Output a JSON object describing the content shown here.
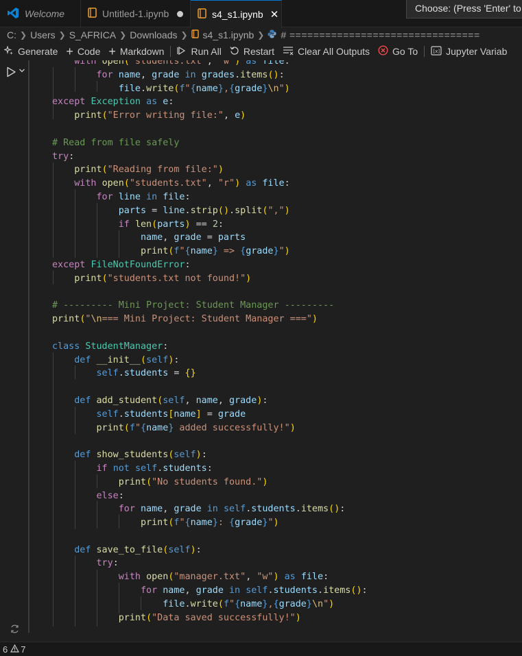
{
  "tabs": [
    {
      "label": "Welcome"
    },
    {
      "label": "Untitled-1.ipynb"
    },
    {
      "label": "s4_s1.ipynb"
    }
  ],
  "command_prompt": "Choose: (Press 'Enter' to co",
  "breadcrumb": {
    "drive": "C:",
    "parts": [
      "Users",
      "S_AFRICA",
      "Downloads",
      "s4_s1.ipynb"
    ],
    "cell": "# ================================"
  },
  "toolbar": {
    "generate": "Generate",
    "code": "Code",
    "markdown": "Markdown",
    "run_all": "Run All",
    "restart": "Restart",
    "clear_outputs": "Clear All Outputs",
    "go_to": "Go To",
    "variables": "Jupyter Variab"
  },
  "status": {
    "errors": "6",
    "warnings": "7"
  },
  "colors": {
    "accent": "#0078d4",
    "editor_bg": "#1f1f1f",
    "error_red": "#f14c4c"
  },
  "code_lines": [
    "with open(\"students.txt\", \"w\") as file:",
    "for name, grade in grades.items():",
    "file.write(f\"{name},{grade}\\n\")",
    "except Exception as e:",
    "print(\"Error writing file:\", e)",
    "",
    "# Read from file safely",
    "try:",
    "print(\"Reading from file:\")",
    "with open(\"students.txt\", \"r\") as file:",
    "for line in file:",
    "parts = line.strip().split(\",\")",
    "if len(parts) == 2:",
    "name, grade = parts",
    "print(f\"{name} => {grade}\")",
    "except FileNotFoundError:",
    "print(\"students.txt not found!\")",
    "",
    "# --------- Mini Project: Student Manager ---------",
    "print(\"\\n=== Mini Project: Student Manager ===\")",
    "",
    "class StudentManager:",
    "def __init__(self):",
    "self.students = {}",
    "",
    "def add_student(self, name, grade):",
    "self.students[name] = grade",
    "print(f\"{name} added successfully!\")",
    "",
    "def show_students(self):",
    "if not self.students:",
    "print(\"No students found.\")",
    "else:",
    "for name, grade in self.students.items():",
    "print(f\"{name}: {grade}\")",
    "",
    "def save_to_file(self):",
    "try:",
    "with open(\"manager.txt\", \"w\") as file:",
    "for name, grade in self.students.items():",
    "file.write(f\"{name},{grade}\\n\")",
    "print(\"Data saved successfully!\")"
  ]
}
